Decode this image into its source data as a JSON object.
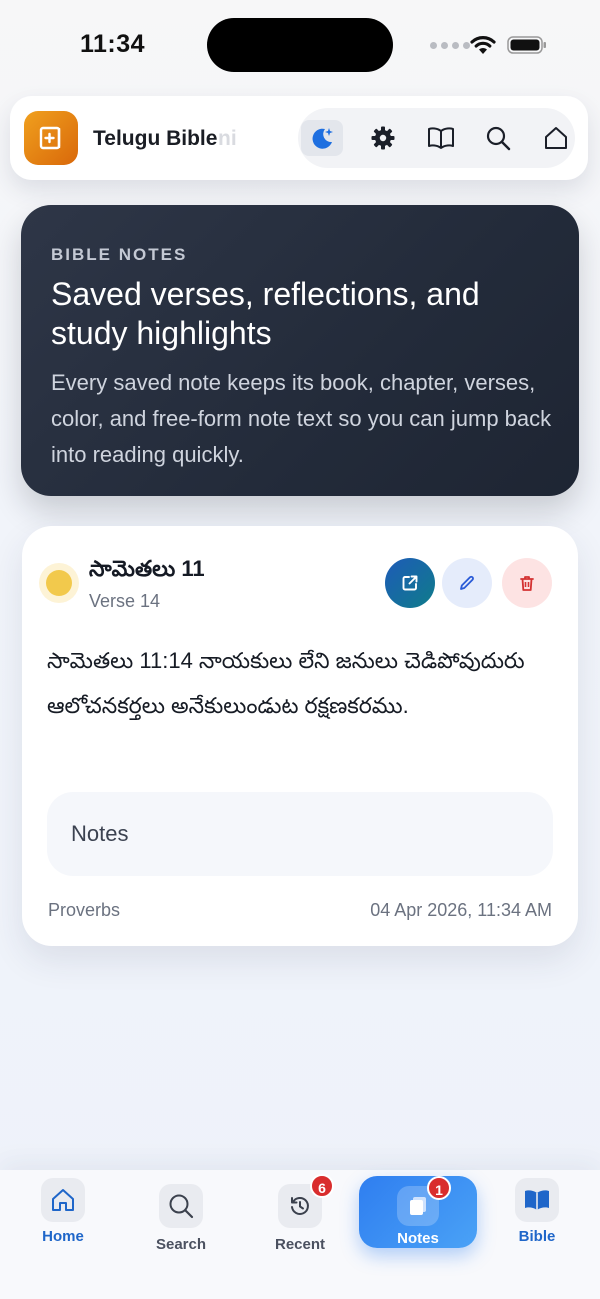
{
  "status_bar": {
    "time": "11:34"
  },
  "top_bar": {
    "title": "Telugu Bible",
    "title_overflow": "ni"
  },
  "hero": {
    "eyebrow": "BIBLE NOTES",
    "title": "Saved verses, reflections, and study highlights",
    "description": "Every saved note keeps its book, chapter, verses, color, and free-form note text so you can jump back into reading quickly."
  },
  "note": {
    "book_chapter": "సామెతలు 11",
    "verse": "Verse 14",
    "text": "సామెతలు 11:14 నాయకులు లేని జనులు చెడిపోవుదురు ఆలోచనకర్తలు అనేకులుండుట రక్షణకరము.",
    "notes_label": "Notes",
    "category": "Proverbs",
    "date": "04 Apr 2026, 11:34 AM",
    "highlight_color": "#f2c94c"
  },
  "bottom_nav": {
    "items": [
      {
        "label": "Home"
      },
      {
        "label": "Search"
      },
      {
        "label": "Recent",
        "badge": "6"
      },
      {
        "label": "Notes",
        "badge": "1"
      },
      {
        "label": "Bible"
      }
    ]
  },
  "colors": {
    "accent": "#2f7ef0",
    "hero_bg": "#232b3a",
    "brand": "#e8830f",
    "badge": "#d92d2d"
  }
}
